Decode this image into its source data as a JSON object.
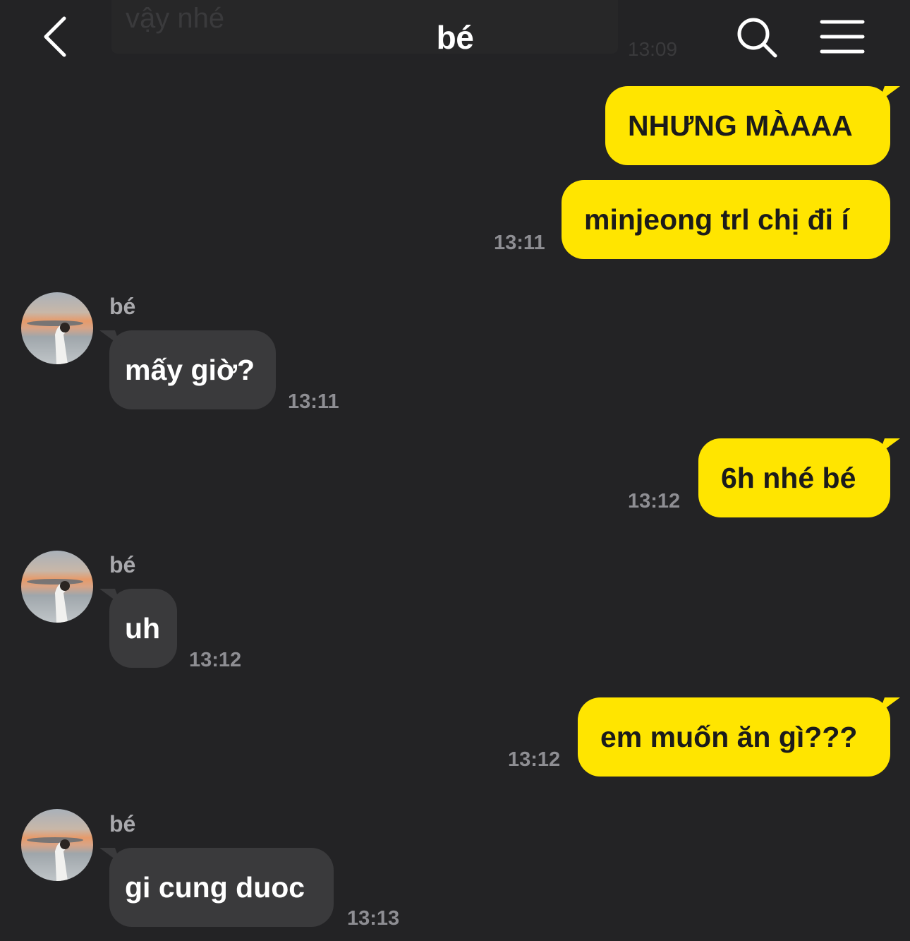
{
  "header": {
    "title": "bé"
  },
  "previous": {
    "text": "vậy nhé",
    "time": "13:09"
  },
  "messages": [
    {
      "text": "NHƯNG MÀAAA"
    },
    {
      "text": "minjeong trl chị đi í",
      "time": "13:11"
    },
    {
      "sender": "bé",
      "text": "mấy giờ?",
      "time": "13:11"
    },
    {
      "text": "6h nhé bé",
      "time": "13:12"
    },
    {
      "sender": "bé",
      "text": "uh",
      "time": "13:12"
    },
    {
      "text": "em muốn ăn gì???",
      "time": "13:12"
    },
    {
      "sender": "bé",
      "text": "gi cung duoc",
      "time": "13:13"
    }
  ],
  "colors": {
    "background": "#232325",
    "outgoing_bubble": "#ffe500",
    "incoming_bubble": "#3a3a3c"
  },
  "icons": {
    "back": "chevron-left-icon",
    "search": "search-icon",
    "menu": "hamburger-menu-icon"
  }
}
